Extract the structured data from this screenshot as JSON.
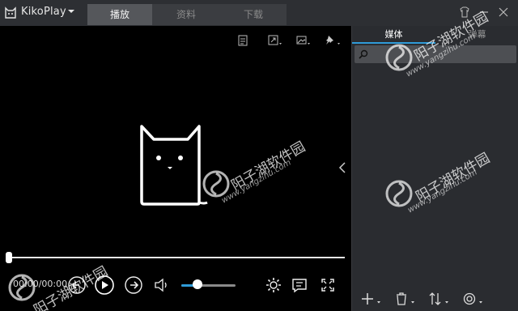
{
  "app": {
    "name": "KikoPlay"
  },
  "tabs": [
    {
      "label": "播放",
      "active": true
    },
    {
      "label": "资料",
      "active": false
    },
    {
      "label": "下载",
      "active": false
    }
  ],
  "player": {
    "time": "00:00/00:00",
    "progress": 0,
    "volume": 0.3
  },
  "side": {
    "tabs": [
      {
        "label": "媒体",
        "active": true
      },
      {
        "label": "弹幕",
        "active": false
      }
    ],
    "search": {
      "value": "",
      "placeholder": ""
    }
  },
  "watermark": {
    "text": "阳子湖软件园",
    "url": "www.yangzihu.com"
  },
  "colors": {
    "accent": "#2f9bd8",
    "panel": "#2a2c30",
    "titlebar": "#2d2f33"
  }
}
